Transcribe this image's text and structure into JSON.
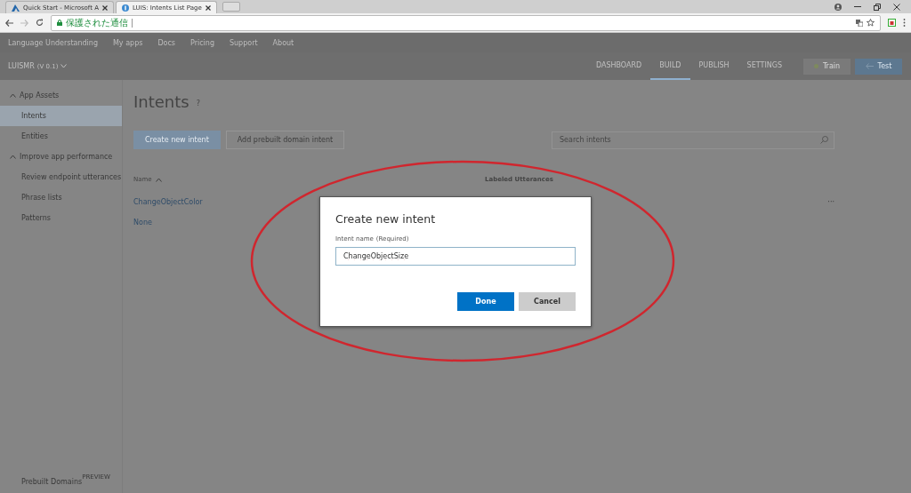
{
  "browser": {
    "tabs": [
      {
        "title": "Quick Start - Microsoft A",
        "selected": false
      },
      {
        "title": "LUIS: Intents List Page",
        "selected": true
      }
    ],
    "address": {
      "security_text": "保護された通信"
    }
  },
  "top_nav": {
    "items": [
      "Language Understanding",
      "My apps",
      "Docs",
      "Pricing",
      "Support",
      "About"
    ]
  },
  "app_bar": {
    "app_name": "LUISMR",
    "version": "(V 0.1)",
    "sections": [
      {
        "label": "DASHBOARD",
        "selected": false
      },
      {
        "label": "BUILD",
        "selected": true
      },
      {
        "label": "PUBLISH",
        "selected": false
      },
      {
        "label": "SETTINGS",
        "selected": false
      }
    ],
    "train_button": "Train",
    "test_button": "Test"
  },
  "sidebar": {
    "groups": [
      {
        "label": "App Assets",
        "expanded": true,
        "children": [
          {
            "label": "Intents",
            "selected": true
          },
          {
            "label": "Entities",
            "selected": false
          }
        ]
      },
      {
        "label": "Improve app performance",
        "expanded": true,
        "children": [
          {
            "label": "Review endpoint utterances",
            "selected": false
          },
          {
            "label": "Phrase lists",
            "selected": false
          },
          {
            "label": "Patterns",
            "selected": false
          }
        ]
      }
    ],
    "footer": {
      "label": "Prebuilt Domains",
      "badge": "PREVIEW"
    }
  },
  "main": {
    "title": "Intents",
    "help": "?",
    "buttons": [
      {
        "label": "Create new intent",
        "kind": "primary"
      },
      {
        "label": "Add prebuilt domain intent",
        "kind": "secondary"
      }
    ],
    "search": {
      "placeholder": "Search intents"
    },
    "columns": [
      "Name",
      "Labeled Utterances"
    ],
    "rows": [
      {
        "name": "ChangeObjectColor",
        "menu": "···"
      },
      {
        "name": "None"
      }
    ]
  },
  "dialog": {
    "title": "Create new intent",
    "field_label": "Intent name",
    "field_note": "(Required)",
    "value": "ChangeObjectSize",
    "buttons": [
      {
        "label": "Done",
        "kind": "primary"
      },
      {
        "label": "Cancel",
        "kind": "secondary"
      }
    ]
  },
  "annotation": {
    "kind": "ellipse"
  }
}
